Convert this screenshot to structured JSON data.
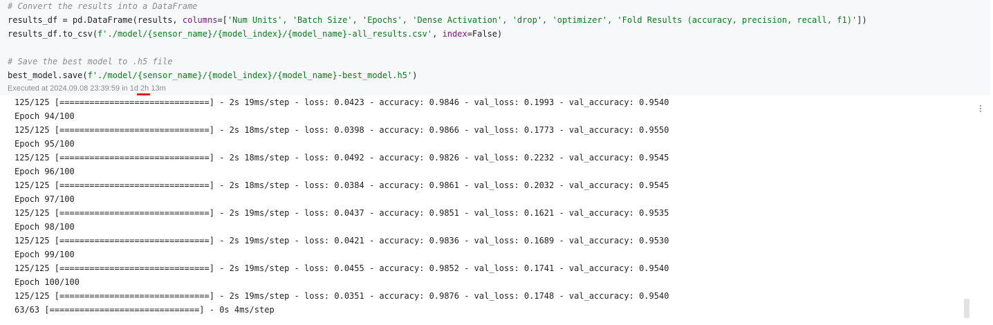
{
  "code_cell": {
    "line1": "# Convert the results into a DataFrame",
    "line2_a": "results_df = pd.DataFrame(results, ",
    "line2_kw": "columns",
    "line2_b": "=[",
    "line2_cols": "'Num Units', 'Batch Size', 'Epochs', 'Dense Activation', 'drop', 'optimizer', 'Fold Results (accuracy, precision, recall, f1)'",
    "line2_c": "])",
    "line3_a": "results_df.to_csv(",
    "line3_str": "f'./model/{sensor_name}/{model_index}/{model_name}-all_results.csv'",
    "line3_b": ", ",
    "line3_kw": "index",
    "line3_c": "=False)",
    "line5": "# Save the best model to .h5 file",
    "line6_a": "best_model.save(",
    "line6_str": "f'./model/{sensor_name}/{model_index}/{model_name}-best_model.h5'",
    "line6_b": ")",
    "executed": "Executed at 2024.09.08 23:39:59 in 1d 2h 13m"
  },
  "output": {
    "lines": [
      "125/125 [==============================] - 2s 19ms/step - loss: 0.0423 - accuracy: 0.9846 - val_loss: 0.1993 - val_accuracy: 0.9540",
      "Epoch 94/100",
      "125/125 [==============================] - 2s 18ms/step - loss: 0.0398 - accuracy: 0.9866 - val_loss: 0.1773 - val_accuracy: 0.9550",
      "Epoch 95/100",
      "125/125 [==============================] - 2s 18ms/step - loss: 0.0492 - accuracy: 0.9826 - val_loss: 0.2232 - val_accuracy: 0.9545",
      "Epoch 96/100",
      "125/125 [==============================] - 2s 18ms/step - loss: 0.0384 - accuracy: 0.9861 - val_loss: 0.2032 - val_accuracy: 0.9545",
      "Epoch 97/100",
      "125/125 [==============================] - 2s 19ms/step - loss: 0.0437 - accuracy: 0.9851 - val_loss: 0.1621 - val_accuracy: 0.9535",
      "Epoch 98/100",
      "125/125 [==============================] - 2s 19ms/step - loss: 0.0421 - accuracy: 0.9836 - val_loss: 0.1689 - val_accuracy: 0.9530",
      "Epoch 99/100",
      "125/125 [==============================] - 2s 19ms/step - loss: 0.0455 - accuracy: 0.9852 - val_loss: 0.1741 - val_accuracy: 0.9540",
      "Epoch 100/100",
      "125/125 [==============================] - 2s 19ms/step - loss: 0.0351 - accuracy: 0.9876 - val_loss: 0.1748 - val_accuracy: 0.9540",
      "63/63 [==============================] - 0s 4ms/step"
    ]
  },
  "icons": {
    "cell_menu": "more-vertical-icon"
  }
}
